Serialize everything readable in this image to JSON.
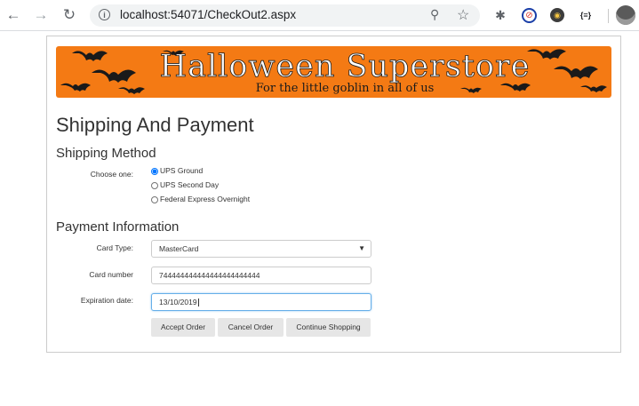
{
  "browser": {
    "url": "localhost:54071/CheckOut2.aspx",
    "extensions": [
      {
        "name": "puzzle-icon",
        "glyph": "✱",
        "color": "#5f6368"
      },
      {
        "name": "blocker-icon",
        "glyph": "⊘",
        "color": "#1a3fa8"
      },
      {
        "name": "shield-extension-icon",
        "glyph": "◉",
        "color": "#c7a22a"
      },
      {
        "name": "json-extension-icon",
        "glyph": "{≡}",
        "color": "#202124"
      }
    ]
  },
  "banner": {
    "title": "Halloween Superstore",
    "tagline": "For the little goblin in all of us"
  },
  "page": {
    "title": "Shipping And Payment"
  },
  "shipping": {
    "heading": "Shipping Method",
    "choose_label": "Choose one:",
    "options": [
      "UPS Ground",
      "UPS Second Day",
      "Federal Express Overnight"
    ],
    "selected": "UPS Ground"
  },
  "payment": {
    "heading": "Payment Information",
    "card_type_label": "Card Type:",
    "card_type_value": "MasterCard",
    "card_number_label": "Card number",
    "card_number_value": "744444444444444444444444",
    "expiration_label": "Expiration date:",
    "expiration_value": "13/10/2019"
  },
  "actions": {
    "accept": "Accept Order",
    "cancel": "Cancel Order",
    "continue": "Continue Shopping"
  },
  "colors": {
    "banner_orange": "#f47a14",
    "focus_border": "#66afe9",
    "button_bg": "#e6e6e6"
  }
}
